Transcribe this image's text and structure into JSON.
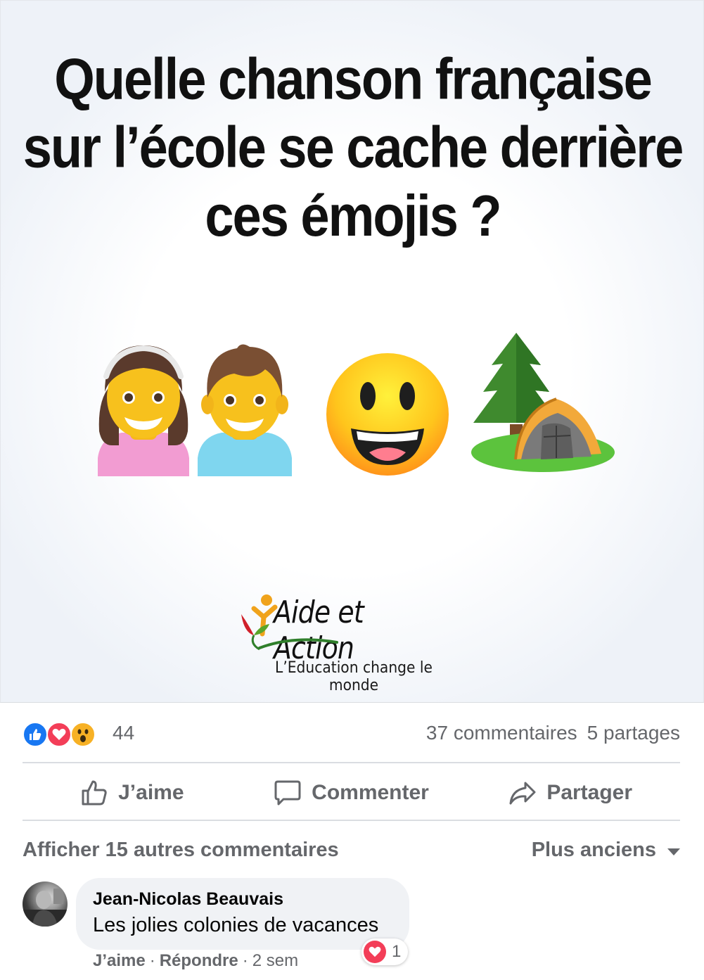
{
  "post": {
    "image": {
      "title_lines": [
        "Quelle chanson française",
        "sur l’école se cache derrière",
        "ces émojis ?"
      ],
      "emojis": [
        "girl-emoji",
        "boy-emoji",
        "grinning-face-emoji",
        "evergreen-tree-emoji",
        "tent-emoji"
      ],
      "logo": {
        "name": "Aide et Action",
        "tagline": "L’Education change le monde"
      }
    },
    "reactions": {
      "icons": [
        "like-reaction-icon",
        "love-reaction-icon",
        "wow-reaction-icon"
      ],
      "count": "44"
    },
    "stats": {
      "comments": "37 commentaires",
      "shares": "5 partages"
    },
    "actions": {
      "like": "J’aime",
      "comment": "Commenter",
      "share": "Partager"
    }
  },
  "comments": {
    "more_label": "Afficher 15 autres commentaires",
    "sort_label": "Plus anciens",
    "items": [
      {
        "author": "Jean-Nicolas Beauvais",
        "text": "Les jolies colonies de vacances",
        "reaction_count": "1",
        "like_label": "J’aime",
        "reply_label": "Répondre",
        "time": "2 sem"
      }
    ]
  },
  "colors": {
    "like_blue": "#1877f2",
    "love_red": "#f33e58",
    "wow_yellow": "#f7b125",
    "secondary_text": "#65676b",
    "divider": "#dadde1",
    "bubble": "#f0f2f5"
  }
}
